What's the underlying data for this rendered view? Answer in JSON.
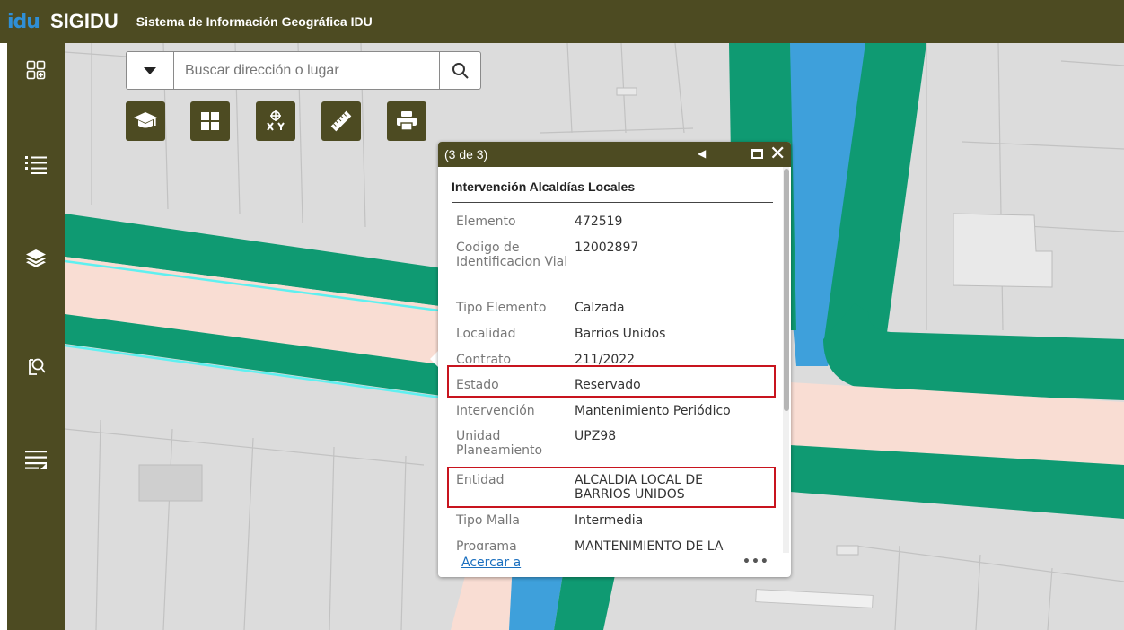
{
  "header": {
    "logo": "idu",
    "app_name": "SIGIDU",
    "subtitle": "Sistema de Información Geográfica IDU",
    "bg_color": "#4d4b22"
  },
  "sidebar": {
    "items": [
      {
        "name": "widgets",
        "icon": "apps-grid-icon"
      },
      {
        "name": "legend",
        "icon": "list-icon"
      },
      {
        "name": "layers",
        "icon": "layers-icon"
      },
      {
        "name": "query",
        "icon": "search-document-icon"
      },
      {
        "name": "attribute-table",
        "icon": "table-list-icon"
      }
    ]
  },
  "search": {
    "placeholder": "Buscar dirección o lugar",
    "value": ""
  },
  "toolbar": {
    "tools": [
      {
        "name": "tutorial",
        "icon": "graduation-cap-icon"
      },
      {
        "name": "basemap",
        "icon": "grid-icon"
      },
      {
        "name": "coordinates",
        "icon": "xy-coordinates-icon"
      },
      {
        "name": "measure",
        "icon": "ruler-icon"
      },
      {
        "name": "print",
        "icon": "printer-icon"
      }
    ]
  },
  "popup": {
    "counter": "(3 de 3)",
    "title": "Intervención Alcaldías Locales",
    "fields": [
      {
        "label": "Elemento",
        "value": "472519"
      },
      {
        "label": "Codigo de Identificacion Vial",
        "value": "12002897"
      },
      {
        "label": "Tipo Elemento",
        "value": "Calzada"
      },
      {
        "label": "Localidad",
        "value": "Barrios Unidos"
      },
      {
        "label": "Contrato",
        "value": "211/2022"
      },
      {
        "label": "Estado",
        "value": "Reservado"
      },
      {
        "label": "Intervención",
        "value": "Mantenimiento Periódico"
      },
      {
        "label": "Unidad Planeamiento",
        "value": "UPZ98"
      },
      {
        "label": "Entidad",
        "value": "ALCALDIA LOCAL DE BARRIOS UNIDOS"
      },
      {
        "label": "Tipo Malla",
        "value": "Intermedia"
      },
      {
        "label": "Programa",
        "value": "MANTENIMIENTO DE LA"
      }
    ],
    "zoom_link": "Acercar a",
    "more": "•••",
    "highlighted_fields": [
      "Estado",
      "Entidad"
    ],
    "highlight_color": "#c8141e"
  },
  "map_colors": {
    "background": "#dcdcdc",
    "road_green": "#0f9a72",
    "road_pink": "#f9ddd3",
    "water_blue": "#3ea0db",
    "cyan_line": "#5ff0f0"
  }
}
